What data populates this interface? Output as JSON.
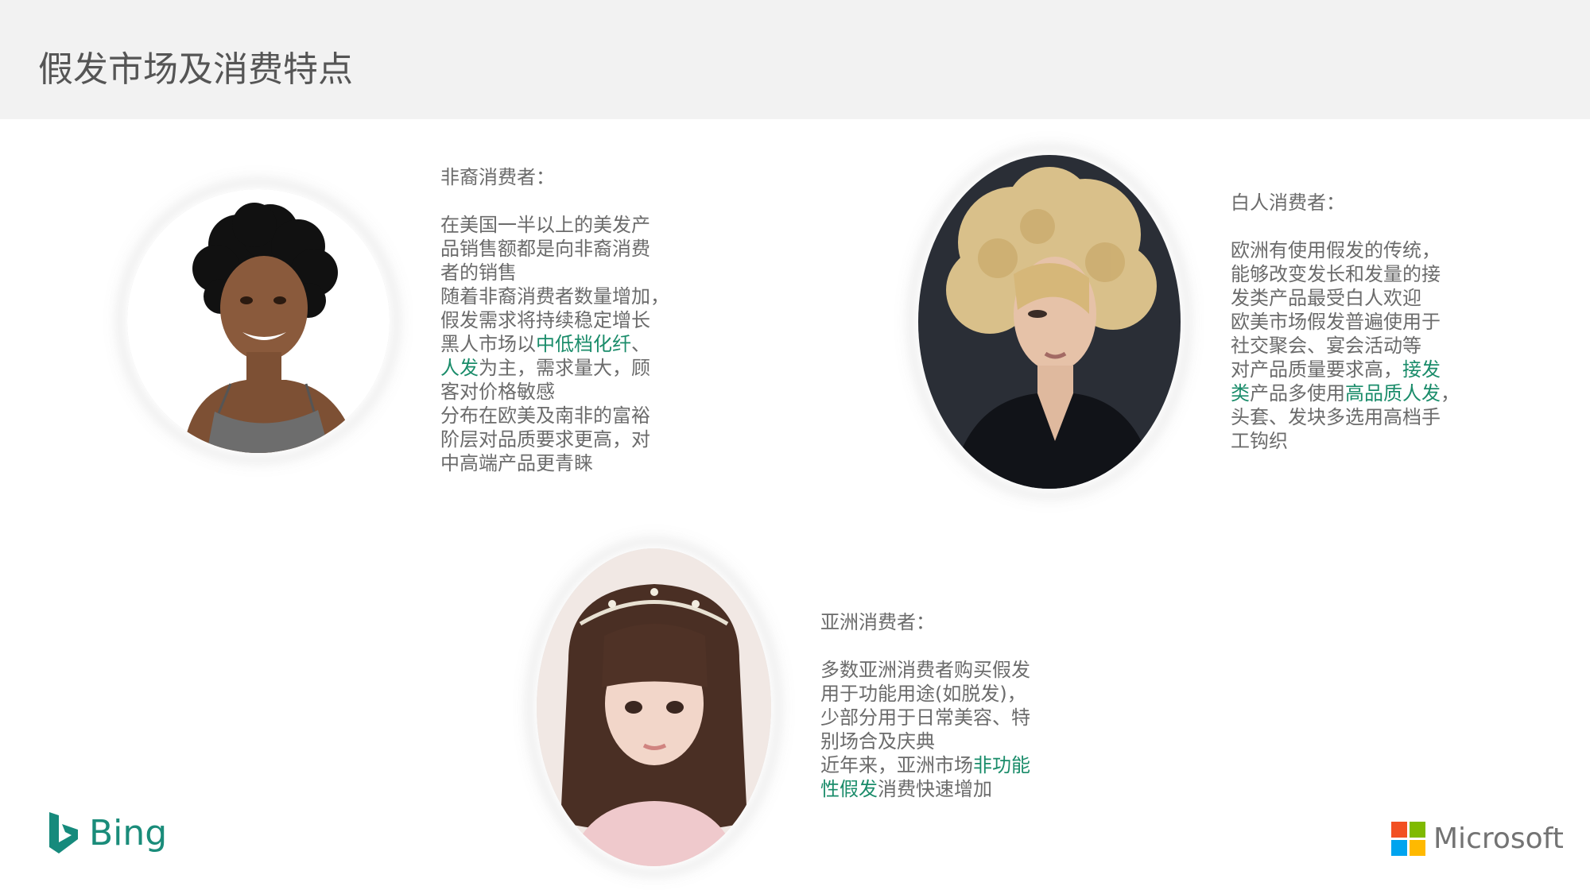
{
  "slide": {
    "title": "假发市场及消费特点"
  },
  "sections": {
    "african": {
      "heading": "非裔消费者：",
      "lines": [
        [
          "在美国一半以上的美发产"
        ],
        [
          "品销售额都是向非裔消费"
        ],
        [
          "者的销售"
        ],
        [
          "随着非裔消费者数量增加，"
        ],
        [
          "假发需求将持续稳定增长"
        ],
        [
          "黑人市场以",
          "中低档化纤",
          "、"
        ],
        [
          "",
          "人发",
          "为主，需求量大，顾"
        ],
        [
          "客对价格敏感"
        ],
        [
          "分布在欧美及南非的富裕"
        ],
        [
          "阶层对品质要求更高，对"
        ],
        [
          "中高端产品更青睐"
        ]
      ]
    },
    "white": {
      "heading": "白人消费者：",
      "lines": [
        [
          "欧洲有使用假发的传统，"
        ],
        [
          "能够改变发长和发量的接"
        ],
        [
          "发类产品最受白人欢迎"
        ],
        [
          "欧美市场假发普遍使用于"
        ],
        [
          "社交聚会、宴会活动等"
        ],
        [
          "对产品质量要求高，",
          "接发"
        ],
        [
          "",
          "类",
          "产品多使用",
          "高品质人发",
          "，"
        ],
        [
          "头套、发块多选用高档手"
        ],
        [
          "工钩织"
        ]
      ]
    },
    "asian": {
      "heading": "亚洲消费者：",
      "lines": [
        [
          "多数亚洲消费者购买假发"
        ],
        [
          "用于功能用途(如脱发)，"
        ],
        [
          "少部分用于日常美容、特"
        ],
        [
          "别场合及庆典"
        ],
        [
          "近年来，亚洲市场",
          "非功能"
        ],
        [
          "",
          "性假发",
          "消费快速增加"
        ]
      ]
    }
  },
  "logos": {
    "bing": "Bing",
    "bing_icon": "bing-logo-icon",
    "microsoft": "Microsoft",
    "microsoft_icon": "microsoft-logo-icon",
    "microsoft_colors": [
      "#f25022",
      "#7fba00",
      "#00a4ef",
      "#ffb900"
    ]
  },
  "colors": {
    "highlight": "#1a8c6a",
    "body_text": "#6b6b6b",
    "header_bg": "#f2f2f2"
  }
}
